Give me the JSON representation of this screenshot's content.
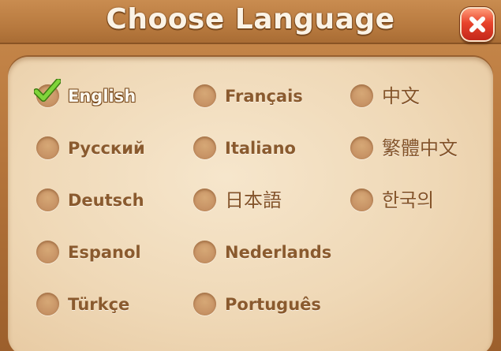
{
  "dialog": {
    "title": "Choose Language",
    "close_icon": "close-icon"
  },
  "languages": {
    "english": "English",
    "russian": "Русский",
    "german": "Deutsch",
    "spanish": "Espanol",
    "turkish": "Türkçe",
    "french": "Français",
    "italian": "Italiano",
    "japanese": "日本語",
    "dutch": "Nederlands",
    "portuguese": "Português",
    "chinese_simplified": "中文",
    "chinese_traditional": "繁體中文",
    "korean": "한국의"
  },
  "selected_language": "English",
  "colors": {
    "frame": "#b3733a",
    "panel": "#efd8b6",
    "label_text": "#8a5a2e",
    "check_green": "#5bbf2a",
    "close_red": "#e8442c"
  }
}
